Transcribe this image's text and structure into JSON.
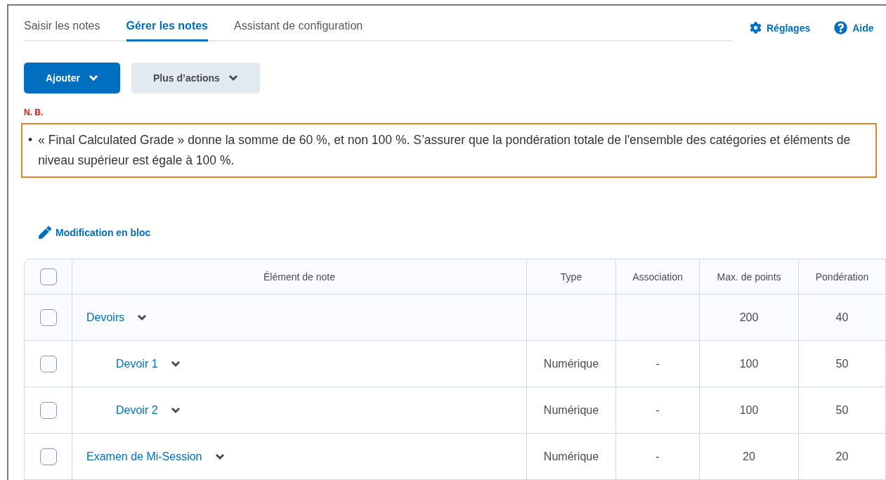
{
  "tabs": [
    {
      "label": "Saisir les notes",
      "selected": false
    },
    {
      "label": "Gérer les notes",
      "selected": true
    },
    {
      "label": "Assistant de configuration",
      "selected": false
    }
  ],
  "top_links": [
    {
      "kind": "settings",
      "label": "Réglages"
    },
    {
      "kind": "help",
      "label": "Aide"
    }
  ],
  "actions": [
    {
      "label": "Ajouter",
      "primary": true
    },
    {
      "label": "Plus d’actions",
      "primary": false
    }
  ],
  "notice": {
    "title": "N. B.",
    "items": [
      {
        "marker": "•",
        "text": "« Final Calculated Grade » donne la somme de 60 %, et non 100 %. S’assurer que la pondération totale de l'ensemble des catégories et éléments de niveau supérieur est égale à 100 %."
      }
    ]
  },
  "bulk_edit": "Modification en bloc",
  "table": {
    "select_all_checked": false,
    "columns": [
      "Élément de note",
      "Type",
      "Association",
      "Max. de points",
      "Pondération"
    ],
    "rows": [
      {
        "kind": "category",
        "name": "Devoirs",
        "checked": false,
        "type": "",
        "association": "",
        "max_points": "200",
        "weight": "40",
        "children": [
          {
            "kind": "item",
            "name": "Devoir 1",
            "checked": false,
            "type": "Numérique",
            "association": "-",
            "max_points": "100",
            "weight": "50"
          },
          {
            "kind": "item",
            "name": "Devoir 2",
            "checked": false,
            "type": "Numérique",
            "association": "-",
            "max_points": "100",
            "weight": "50"
          }
        ]
      },
      {
        "kind": "item",
        "name": "Examen de Mi-Session",
        "checked": false,
        "type": "Numérique",
        "association": "-",
        "max_points": "20",
        "weight": "20"
      }
    ]
  }
}
